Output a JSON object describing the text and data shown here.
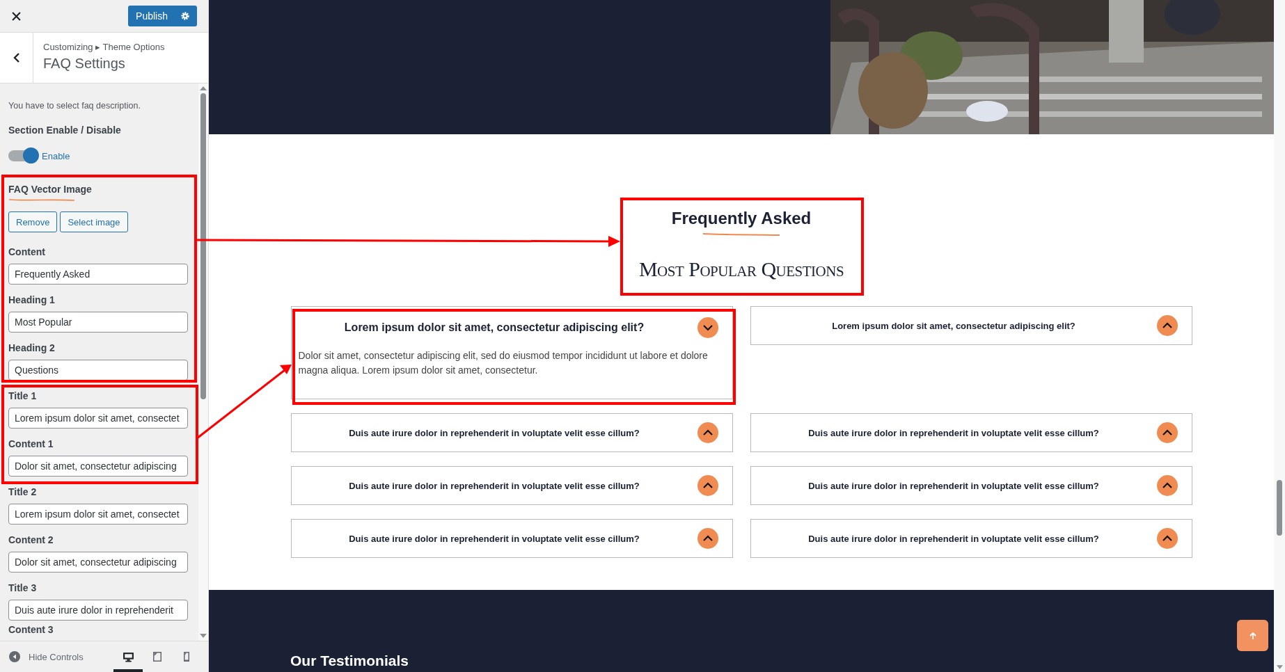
{
  "customizer": {
    "publish_button": "Publish",
    "breadcrumb": "Customizing ▸ Theme Options",
    "title": "FAQ Settings",
    "description": "You have to select faq description.",
    "section_toggle": {
      "label": "Section Enable / Disable",
      "on": true,
      "text": "Enable"
    },
    "vector_image": {
      "label": "FAQ Vector Image",
      "buttons": [
        "Remove",
        "Select image"
      ]
    },
    "fields": [
      {
        "label": "Content",
        "value": "Frequently Asked"
      },
      {
        "label": "Heading 1",
        "value": "Most Popular"
      },
      {
        "label": "Heading 2",
        "value": "Questions"
      },
      {
        "label": "Title 1",
        "value": "Lorem ipsum dolor sit amet, consectet"
      },
      {
        "label": "Content 1",
        "value": "Dolor sit amet, consectetur adipiscing"
      },
      {
        "label": "Title 2",
        "value": "Lorem ipsum dolor sit amet, consectet"
      },
      {
        "label": "Content 2",
        "value": "Dolor sit amet, consectetur adipiscing"
      },
      {
        "label": "Title 3",
        "value": "Duis aute irure dolor in reprehenderit"
      }
    ],
    "cut_label": "Content 3",
    "hide_controls": "Hide Controls",
    "devices": [
      {
        "kind": "desktop",
        "selected": true
      },
      {
        "kind": "tablet",
        "selected": false
      },
      {
        "kind": "mobile",
        "selected": false
      }
    ]
  },
  "preview": {
    "faq_subtitle": "Frequently Asked",
    "faq_heading": "Most Popular Questions",
    "faq_items": [
      {
        "question": "Lorem ipsum dolor sit amet, consectetur adipiscing elit?",
        "expanded": true,
        "answer": "Dolor sit amet, consectetur adipiscing elit, sed do eiusmod tempor incididunt ut labore et dolore magna aliqua. Lorem ipsum dolor sit amet, consectetur."
      },
      {
        "question": "Lorem ipsum dolor sit amet, consectetur adipiscing elit?",
        "expanded": false
      },
      {
        "question": "Duis aute irure dolor in reprehenderit in voluptate velit esse cillum?",
        "expanded": false
      },
      {
        "question": "Duis aute irure dolor in reprehenderit in voluptate velit esse cillum?",
        "expanded": false
      },
      {
        "question": "Duis aute irure dolor in reprehenderit in voluptate velit esse cillum?",
        "expanded": false
      },
      {
        "question": "Duis aute irure dolor in reprehenderit in voluptate velit esse cillum?",
        "expanded": false
      },
      {
        "question": "Duis aute irure dolor in reprehenderit in voluptate velit esse cillum?",
        "expanded": false
      },
      {
        "question": "Duis aute irure dolor in reprehenderit in voluptate velit esse cillum?",
        "expanded": false
      }
    ],
    "testimonials_heading": "Our Testimonials"
  }
}
